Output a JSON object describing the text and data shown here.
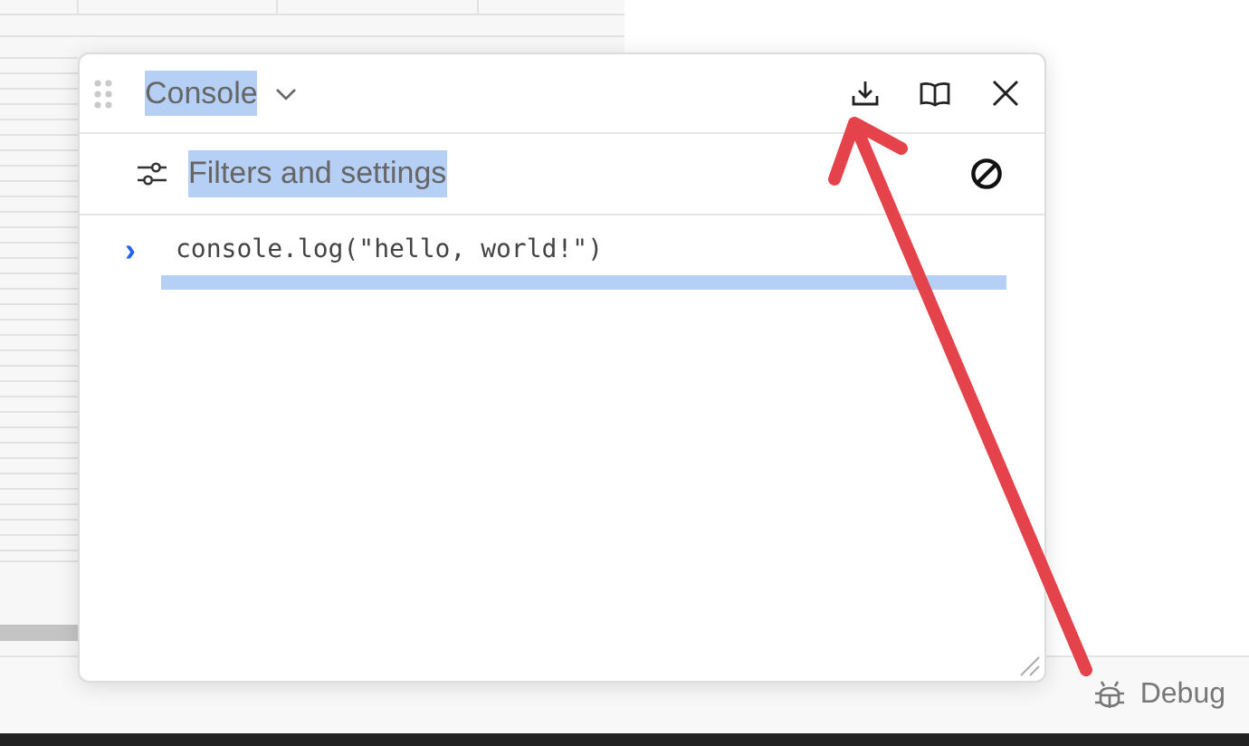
{
  "console_panel": {
    "title": "Console",
    "title_highlighted": true,
    "filters": {
      "label": "Filters and settings",
      "highlighted": true
    },
    "entries": [
      {
        "prompt": "›",
        "code": "console.log(\"hello, world!\")",
        "trailing_line_highlighted": true
      }
    ]
  },
  "status_bar": {
    "debug_label": "Debug"
  }
}
